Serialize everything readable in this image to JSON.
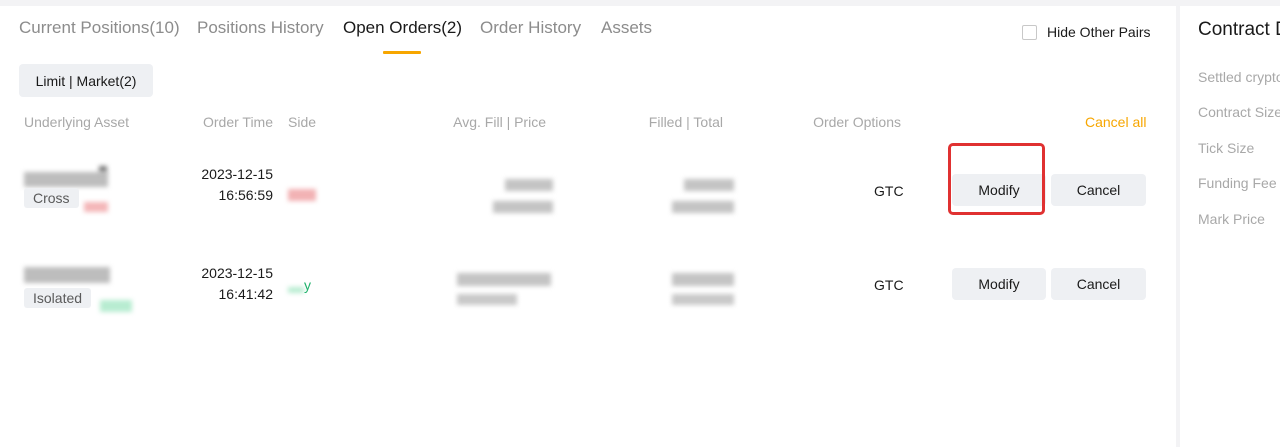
{
  "tabs": [
    {
      "label": "Current Positions(10)"
    },
    {
      "label": "Positions History"
    },
    {
      "label": "Open Orders(2)"
    },
    {
      "label": "Order History"
    },
    {
      "label": "Assets"
    }
  ],
  "active_tab": "Open Orders(2)",
  "hide_other_pairs": {
    "label": "Hide Other Pairs",
    "checked": false
  },
  "filter": {
    "label": "Limit | Market(2)"
  },
  "columns": {
    "underlying_asset": "Underlying Asset",
    "order_time": "Order Time",
    "side": "Side",
    "avg_fill_price": "Avg. Fill | Price",
    "filled_total": "Filled | Total",
    "order_options": "Order Options"
  },
  "cancel_all_label": "Cancel all",
  "orders": [
    {
      "margin_mode": "Cross",
      "date": "2023-12-15",
      "time": "16:56:59",
      "order_option": "GTC",
      "modify_label": "Modify",
      "cancel_label": "Cancel"
    },
    {
      "margin_mode": "Isolated",
      "date": "2023-12-15",
      "time": "16:41:42",
      "side_partial": "y",
      "order_option": "GTC",
      "modify_label": "Modify",
      "cancel_label": "Cancel"
    }
  ],
  "side_panel": {
    "title": "Contract D",
    "rows": [
      "Settled crypto",
      "Contract Size",
      "Tick Size",
      "Funding Fee",
      "Mark Price"
    ]
  },
  "colors": {
    "accent": "#f7a600",
    "highlight": "#e03131",
    "buy": "#20b26c",
    "sell": "#ef454a"
  }
}
